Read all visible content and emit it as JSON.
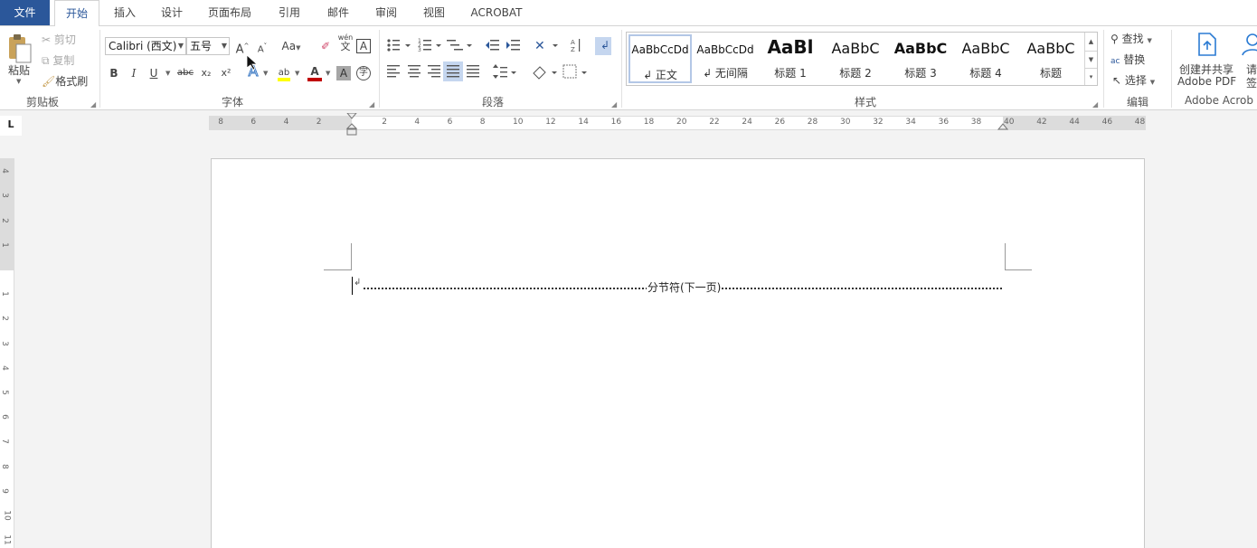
{
  "tabs": [
    "文件",
    "开始",
    "插入",
    "设计",
    "页面布局",
    "引用",
    "邮件",
    "审阅",
    "视图",
    "ACROBAT"
  ],
  "clipboard": {
    "paste": "粘贴",
    "cut": "剪切",
    "copy": "复制",
    "format_painter": "格式刷",
    "group": "剪贴板"
  },
  "font": {
    "name": "Calibri (西文)",
    "size": "五号",
    "group": "字体",
    "bold": "B",
    "italic": "I",
    "underline": "U",
    "strike": "abc",
    "subscript": "x₂",
    "superscript": "x²",
    "grow": "A",
    "shrink": "A",
    "case": "Aa",
    "phonetic_top": "wén",
    "phonetic_bottom": "文",
    "charborder": "A",
    "color_letter": "A",
    "shade_letter": "A",
    "enclose": "字",
    "effects": "A",
    "highlight": "ab"
  },
  "paragraph": {
    "group": "段落"
  },
  "styles": {
    "group": "样式",
    "items": [
      {
        "preview": "AaBbCcDd",
        "name": "↲ 正文",
        "selected": true
      },
      {
        "preview": "AaBbCcDd",
        "name": "↲ 无间隔"
      },
      {
        "preview": "AaBl",
        "name": "标题 1"
      },
      {
        "preview": "AaBbC",
        "name": "标题 2"
      },
      {
        "preview": "AaBbC",
        "name": "标题 3"
      },
      {
        "preview": "AaBbC",
        "name": "标题 4"
      },
      {
        "preview": "AaBbC",
        "name": "标题"
      }
    ]
  },
  "editing": {
    "find": "查找",
    "replace": "替换",
    "select": "选择",
    "group": "编辑"
  },
  "acrobat": {
    "create_line1": "创建并共享",
    "create_line2": "Adobe PDF",
    "request_line1": "请",
    "request_line2": "签",
    "group": "Adobe Acrob"
  },
  "ruler": {
    "corner": "L",
    "h_numbers": [
      "8",
      "6",
      "4",
      "2",
      "2",
      "4",
      "6",
      "8",
      "10",
      "12",
      "14",
      "16",
      "18",
      "20",
      "22",
      "24",
      "26",
      "28",
      "30",
      "32",
      "34",
      "36",
      "38",
      "40",
      "42",
      "44",
      "46",
      "48"
    ],
    "v_numbers": [
      "4",
      "3",
      "2",
      "1",
      "1",
      "2",
      "3",
      "4",
      "5",
      "6",
      "7",
      "8",
      "9",
      "10",
      "11"
    ]
  },
  "document": {
    "section_break": "分节符(下一页)",
    "colors": {
      "accent": "#2b579a",
      "page": "#ffffff",
      "workspace": "#f3f3f3"
    }
  }
}
